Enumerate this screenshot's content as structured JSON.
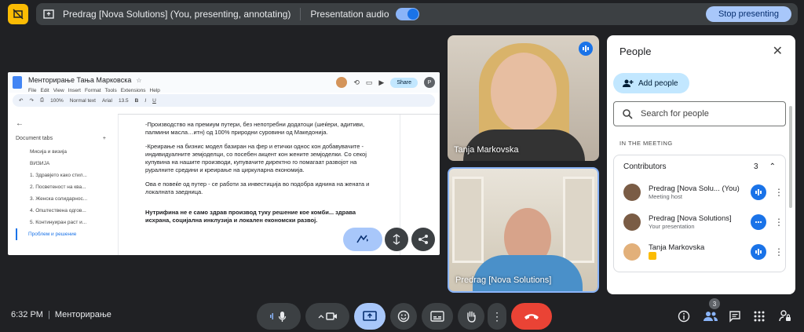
{
  "top_bar": {
    "presenter_title": "Predrag [Nova Solutions] (You, presenting, annotating)",
    "audio_label": "Presentation audio",
    "stop_label": "Stop presenting"
  },
  "doc": {
    "title": "Менторирање Тања Марковска",
    "menus": [
      "File",
      "Edit",
      "View",
      "Insert",
      "Format",
      "Tools",
      "Extensions",
      "Help"
    ],
    "share_label": "Share",
    "avatar_letter": "P",
    "toolbar": {
      "zoom": "100%",
      "style": "Normal text",
      "font": "Arial",
      "size": "13.5"
    },
    "tabs_label": "Document tabs",
    "tabs": [
      "Мисија и визија",
      "ВИЗИЈА",
      "1. Здравјето како стил...",
      "2. Посветеност на ква...",
      "3. Женска солидарнос...",
      "4. Општествена одгов...",
      "5. Континуиран раст и...",
      "Проблем и решение"
    ],
    "paragraphs": [
      "-Производство на премиум путери, без непотребни додатоци (шеќери, адитиви, палмини масла…итн) од 100% природни суровини од Македонија.",
      "-Креирање на бизнис модел базиран на фер и етички однос кон добавувачите - индивидуалните земјоделци, со посебен акцент кон жените земјоделки. Со секој купувина на нашите производи, купувачите директно го помагаат развојот на руралните средини и креирање на циркуларна економија.",
      "Ова е повеќе од путер - се работи за инвестиција во подобра иднина на жената и локалната заедница."
    ],
    "bold_paragraph": "Нутрифина не е само здрав производ туку решение кое комби... здрава исхрана, социјална инклузија и локален економски развој."
  },
  "tiles": {
    "tile1_name": "Tanja Markovska",
    "tile2_name": "Predrag [Nova Solutions]"
  },
  "people": {
    "title": "People",
    "add_label": "Add people",
    "search_placeholder": "Search for people",
    "in_meeting": "IN THE MEETING",
    "contributors_label": "Contributors",
    "contributors_count": "3",
    "list": [
      {
        "name": "Predrag [Nova Solu...  (You)",
        "sub": "Meeting host"
      },
      {
        "name": "Predrag [Nova Solutions]",
        "sub": "Your presentation"
      },
      {
        "name": "Tanja Markovska",
        "sub": ""
      }
    ]
  },
  "bottom": {
    "time": "6:32 PM",
    "meeting_name": "Менторирање",
    "people_count": "3"
  }
}
